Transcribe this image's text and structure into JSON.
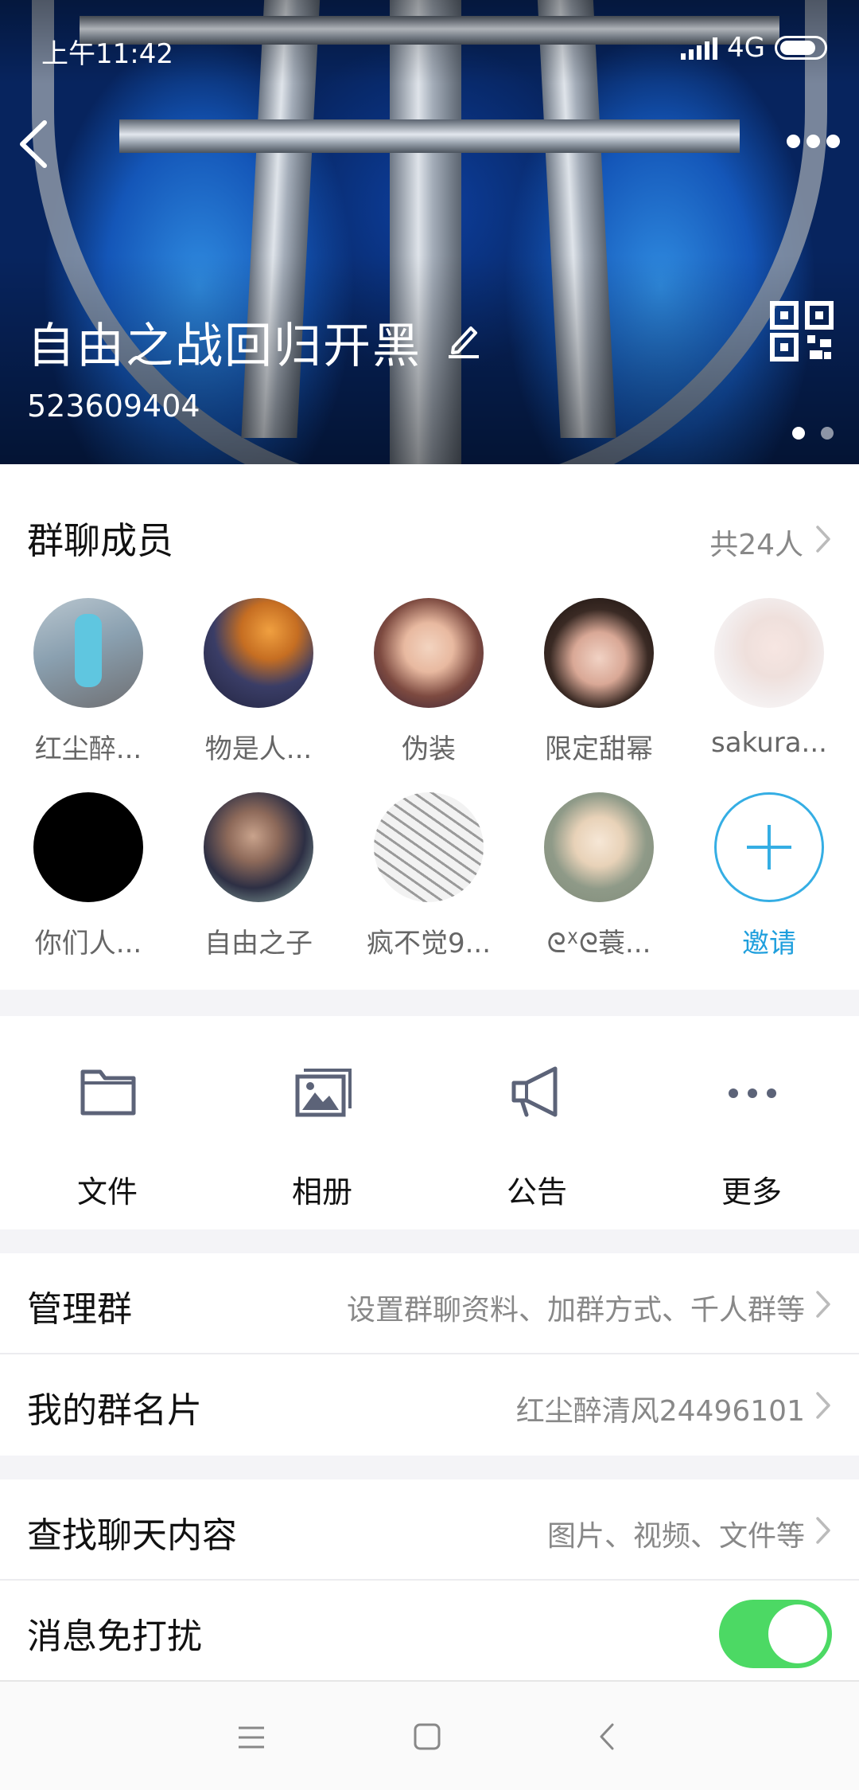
{
  "status_bar": {
    "time": "上午11:42",
    "network": "4G"
  },
  "header": {
    "group_name": "自由之战回归开黑",
    "group_id": "523609404",
    "back_icon": "chevron-left-icon",
    "more_icon": "more-horizontal-icon",
    "edit_icon": "pencil-icon",
    "qr_icon": "qr-code-icon",
    "pager_total": 2,
    "pager_active": 1
  },
  "members": {
    "title": "群聊成员",
    "count": "共24人",
    "items": [
      {
        "name": "红尘醉...",
        "avatar_color": "#8aa0b0"
      },
      {
        "name": "物是人...",
        "avatar_color": "#3a3d66"
      },
      {
        "name": "伪装",
        "avatar_color": "#7d4a40"
      },
      {
        "name": "限定甜幂",
        "avatar_color": "#3a2a24"
      },
      {
        "name": "sakura...",
        "avatar_color": "#f2ecec"
      },
      {
        "name": "你们人...",
        "avatar_color": "#000000"
      },
      {
        "name": "自由之子",
        "avatar_color": "#2d2f44"
      },
      {
        "name": "疯不觉9...",
        "avatar_color": "#cfcfcf"
      },
      {
        "name": "ᘓᕽᘓ蓑...",
        "avatar_color": "#8f9a88"
      }
    ],
    "invite_label": "邀请",
    "accent": "#1f9fdd"
  },
  "actions": [
    {
      "label": "文件",
      "icon": "folder-icon"
    },
    {
      "label": "相册",
      "icon": "photo-album-icon"
    },
    {
      "label": "公告",
      "icon": "megaphone-icon"
    },
    {
      "label": "更多",
      "icon": "more-horizontal-icon"
    }
  ],
  "settings": {
    "manage": {
      "label": "管理群",
      "value": "设置群聊资料、加群方式、千人群等"
    },
    "card": {
      "label": "我的群名片",
      "value": "红尘醉清风24496101"
    },
    "search": {
      "label": "查找聊天内容",
      "value": "图片、视频、文件等"
    },
    "dnd": {
      "label": "消息免打扰",
      "enabled": true,
      "color": "#4cd964"
    }
  },
  "nav_bar": {
    "icons": [
      "menu-icon",
      "home-square-icon",
      "back-icon"
    ]
  }
}
